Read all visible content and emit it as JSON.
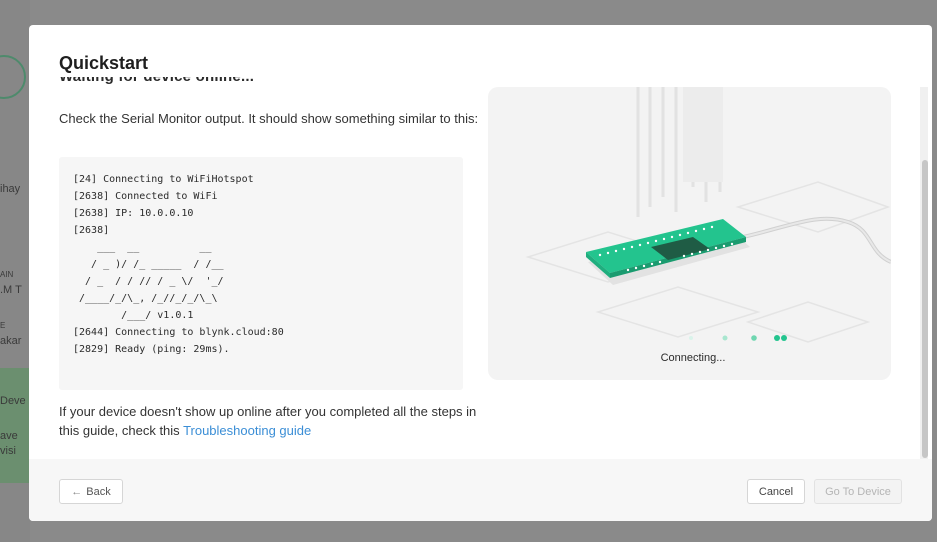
{
  "background": {
    "text_lines": [
      "ihay",
      "AIN",
      ".M T",
      "E",
      "akar",
      "Deve",
      "ave",
      "visi"
    ]
  },
  "modal": {
    "title": "Quickstart",
    "section_heading": "Waiting for device online...",
    "instruction": "Check the Serial Monitor output. It should show something similar to this:",
    "serial_output": [
      "[24] Connecting to WiFiHotspot",
      "[2638] Connected to WiFi",
      "[2638] IP: 10.0.0.10",
      "[2638]",
      "    ___  __          __",
      "   / _ )/ /_ _____  / /__",
      "  / _  / / // / _ \\/  '_/",
      " /____/_/\\_, /_//_/_/\\_\\",
      "        /___/ v1.0.1",
      "[2644] Connecting to blynk.cloud:80",
      "[2829] Ready (ping: 29ms)."
    ],
    "note_text": "If your device doesn't show up online after you completed all the steps in this guide, check this ",
    "troubleshooting_link": "Troubleshooting guide",
    "status_text": "Connecting...",
    "accent_color": "#23c48e"
  },
  "footer": {
    "back_label": "Back",
    "back_icon": "arrow-left-icon",
    "cancel_label": "Cancel",
    "go_label": "Go To Device"
  }
}
